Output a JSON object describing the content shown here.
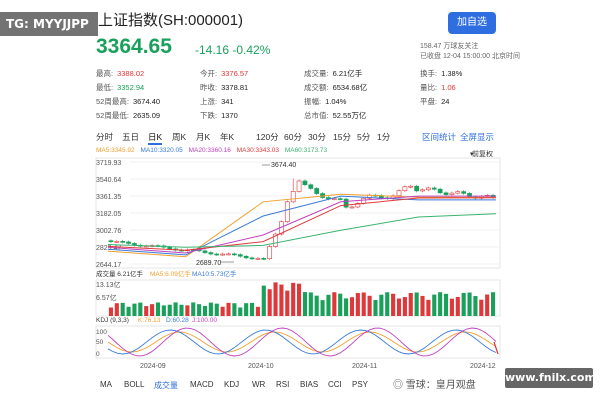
{
  "watermark_top": "TG: MYYJJPP",
  "title": "上证指数(SH:000001)",
  "follow_button": "加自选",
  "price": "3364.65",
  "change": "-14.16 -0.42%",
  "meta_line1": "158.47 万球友关注",
  "meta_line2": "已收盘 12-04 15:00:00 北京时间",
  "stats": {
    "high_label": "最高:",
    "high": "3388.02",
    "low_label": "最低:",
    "low": "3352.94",
    "high52_label": "52周最高:",
    "high52": "3674.40",
    "low52_label": "52周最低:",
    "low52": "2635.09",
    "open_label": "今开:",
    "open": "3376.57",
    "prev_label": "昨收:",
    "prev": "3378.81",
    "up_label": "上涨:",
    "up": "341",
    "down_label": "下跌:",
    "down": "1370",
    "vol_label": "成交量:",
    "vol": "6.21亿手",
    "amt_label": "成交额:",
    "amt": "6534.68亿",
    "amp_label": "振幅:",
    "amp": "1.04%",
    "mcap_label": "总市值:",
    "mcap": "52.55万亿",
    "turnover_label": "换手:",
    "turnover": "1.38%",
    "ratio_label": "量比:",
    "ratio": "1.06",
    "flat_label": "平盘:",
    "flat": "24"
  },
  "period_tabs": [
    "分时",
    "五日",
    "日K",
    "周K",
    "月K",
    "年K",
    "120分",
    "60分",
    "30分",
    "15分",
    "5分",
    "1分"
  ],
  "active_period": "日K",
  "right_tabs": [
    "区间统计",
    "全屏显示"
  ],
  "ma_legend": {
    "ma5": "MA5:3345.92",
    "ma10": "MA10:3320.05",
    "ma20": "MA20:3360.16",
    "ma30": "MA30:3343.03",
    "ma60": "MA60:3173.73"
  },
  "adjust_label": "前复权",
  "price_axis": [
    "3719.93",
    "3540.64",
    "3361.35",
    "3182.05",
    "3002.76",
    "2823.47",
    "2644.17"
  ],
  "annotations": {
    "peak": "3674.40",
    "trough": "2689.70"
  },
  "volume_axis": [
    "13.13亿",
    "6.57亿"
  ],
  "volume_legend": {
    "label": "成交量 6.21亿手",
    "ma5": "MA5:6.09亿手",
    "ma10": "MA10:5.73亿手"
  },
  "kdj_legend": {
    "label": "KDJ (9,3,3)",
    "k": "K:76.13",
    "d": "D:60.28",
    "j": "J:100.00"
  },
  "kdj_axis": [
    "100",
    "50",
    "0"
  ],
  "date_axis": [
    "2024-09",
    "2024-10",
    "2024-11",
    "2024-12"
  ],
  "indicator_tabs": [
    "MA",
    "BOLL",
    "成交量",
    "MACD",
    "KDJ",
    "WR",
    "RSI",
    "BIAS",
    "CCI",
    "PSY"
  ],
  "active_indicator": "成交量",
  "snowball": "◎ 雪球：皇月观盘",
  "watermark_bottom": "www.fnilx.com",
  "colors": {
    "up": "#e0383a",
    "down": "#19a05b",
    "accent": "#2f6ee0",
    "ma5": "#f0a030",
    "ma10": "#3a7ad8",
    "ma20": "#c040c0",
    "ma30": "#e03a3a",
    "ma60": "#3cb371"
  },
  "chart_data": {
    "type": "line",
    "x": [
      "2024-09",
      "2024-10",
      "2024-11",
      "2024-12"
    ],
    "price_range": [
      2644.17,
      3719.93
    ],
    "series": [
      {
        "name": "MA5",
        "values": [
          2780,
          2720,
          3300,
          3380,
          3350,
          3346
        ]
      },
      {
        "name": "MA10",
        "values": [
          2800,
          2740,
          3150,
          3360,
          3320,
          3320
        ]
      },
      {
        "name": "MA20",
        "values": [
          2820,
          2760,
          2950,
          3300,
          3360,
          3360
        ]
      },
      {
        "name": "MA30",
        "values": [
          2830,
          2790,
          2880,
          3260,
          3340,
          3343
        ]
      },
      {
        "name": "MA60",
        "values": [
          2850,
          2820,
          2840,
          3000,
          3140,
          3174
        ]
      }
    ]
  }
}
